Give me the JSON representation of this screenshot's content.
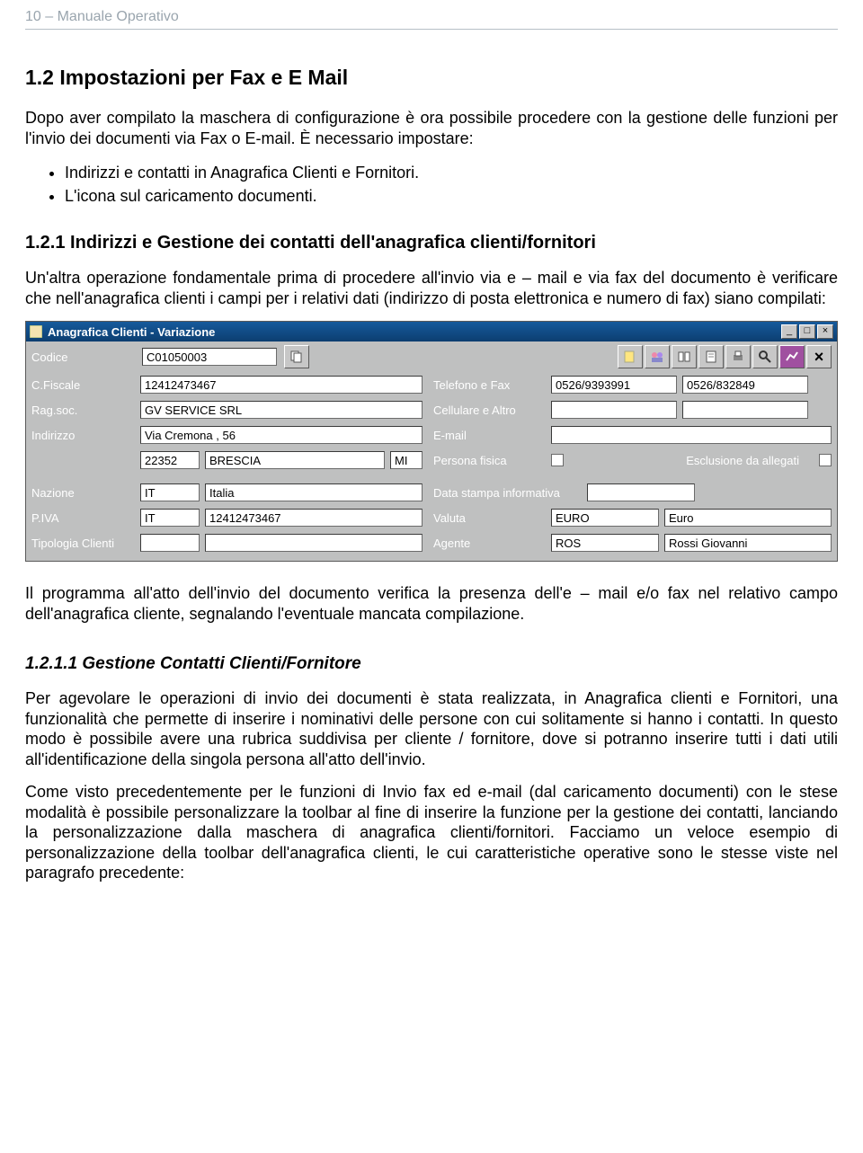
{
  "page_header": "10 – Manuale Operativo",
  "section_1_2": {
    "title": "1.2  Impostazioni per Fax e E Mail",
    "p1": "Dopo aver compilato la maschera di configurazione è ora possibile procedere con la gestione delle funzioni per l'invio dei documenti via Fax o E-mail. È necessario impostare:",
    "bullets": [
      "Indirizzi e contatti in Anagrafica Clienti e Fornitori.",
      "L'icona sul caricamento documenti."
    ]
  },
  "section_1_2_1": {
    "title": "1.2.1  Indirizzi e Gestione dei contatti dell'anagrafica clienti/fornitori",
    "p1": "Un'altra operazione fondamentale prima di procedere all'invio via e – mail e via fax del documento è verificare che nell'anagrafica clienti i campi per i relativi dati (indirizzo di posta elettronica e numero di fax) siano compilati:"
  },
  "window": {
    "title": "Anagrafica Clienti - Variazione",
    "labels": {
      "codice": "Codice",
      "cfiscale": "C.Fiscale",
      "ragsoc": "Rag.soc.",
      "indirizzo": "Indirizzo",
      "nazione": "Nazione",
      "piva": "P.IVA",
      "tipologia": "Tipologia Clienti",
      "telefono_fax": "Telefono e Fax",
      "cellulare_altro": "Cellulare e Altro",
      "email": "E-mail",
      "persona_fisica": "Persona fisica",
      "esclusione_allegati": "Esclusione da allegati",
      "data_stampa": "Data stampa informativa",
      "valuta": "Valuta",
      "agente": "Agente"
    },
    "values": {
      "codice": "C01050003",
      "cfiscale": "12412473467",
      "ragsoc": "GV SERVICE SRL",
      "indirizzo": "Via Cremona , 56",
      "cap": "22352",
      "citta": "BRESCIA",
      "prov": "MI",
      "naz_code": "IT",
      "naz_desc": "Italia",
      "piva_prefix": "IT",
      "piva": "12412473467",
      "tipologia": "",
      "telefono": "0526/9393991",
      "fax": "0526/832849",
      "cellulare": "",
      "altro": "",
      "email": "",
      "data_stampa": "",
      "valuta_code": "EURO",
      "valuta_desc": "Euro",
      "agente_code": "ROS",
      "agente_desc": "Rossi Giovanni"
    }
  },
  "after_window": {
    "p1": "Il programma all'atto dell'invio del documento verifica la presenza dell'e – mail e/o fax nel relativo campo dell'anagrafica cliente, segnalando l'eventuale mancata compilazione."
  },
  "section_1_2_1_1": {
    "title": "1.2.1.1   Gestione Contatti Clienti/Fornitore",
    "p1": "Per agevolare le operazioni di invio dei documenti è stata realizzata, in Anagrafica clienti e Fornitori, una funzionalità che permette di inserire i nominativi delle persone con cui solitamente si hanno i contatti. In questo modo è possibile avere una rubrica suddivisa per cliente / fornitore, dove si potranno inserire tutti i dati utili all'identificazione della singola persona all'atto dell'invio.",
    "p2": "Come visto precedentemente per le funzioni di Invio fax ed e-mail (dal caricamento documenti) con le stese modalità è possibile personalizzare la toolbar al fine di inserire la funzione per la gestione dei contatti, lanciando la personalizzazione dalla maschera di anagrafica clienti/fornitori. Facciamo un veloce esempio di personalizzazione della toolbar dell'anagrafica clienti, le cui caratteristiche operative sono le stesse viste nel paragrafo precedente:"
  }
}
